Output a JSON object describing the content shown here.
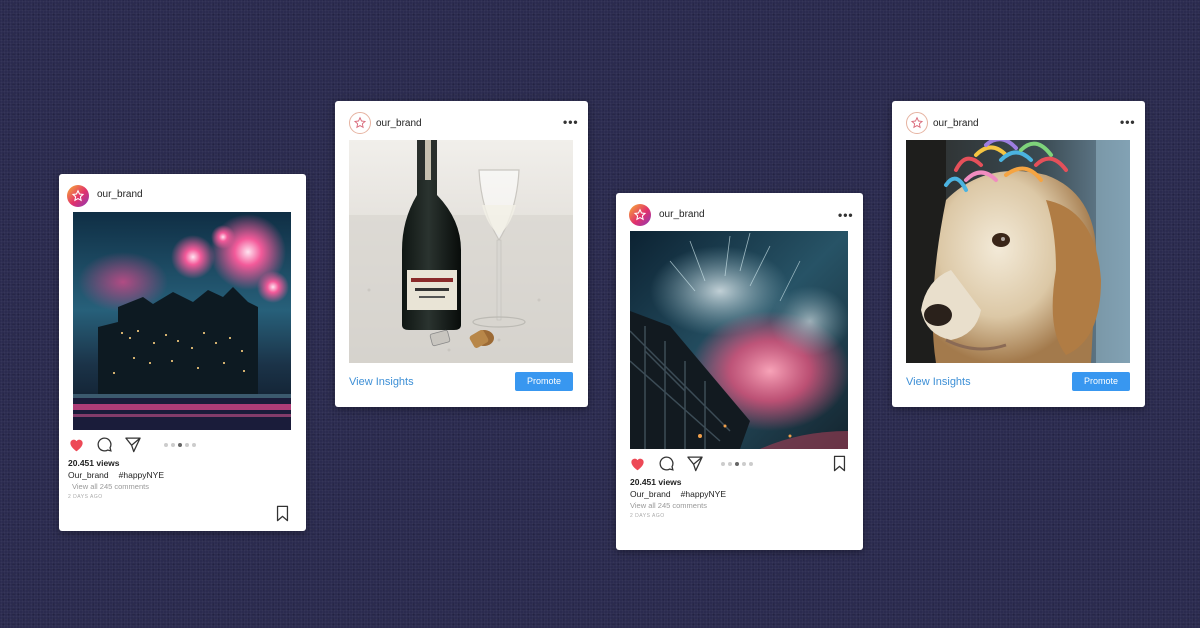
{
  "colors": {
    "background": "#2b2b4f",
    "card": "#ffffff",
    "link": "#3d8fd6",
    "button": "#3897f0",
    "heart": "#ed4956"
  },
  "posts": [
    {
      "username": "our_brand",
      "photo": "City skyline at night with pink fireworks over a waterfront",
      "views": "20.451 views",
      "caption_user": "Our_brand",
      "hashtag": "#happyNYE",
      "comments": "View all 245 comments",
      "time_ago": "2 DAYS AGO",
      "carousel_active": 2,
      "carousel_count": 5,
      "icons": {
        "more": "more-options-icon",
        "like": "heart-icon",
        "comment": "comment-icon",
        "share": "share-icon",
        "save": "bookmark-icon"
      }
    },
    {
      "username": "our_brand",
      "photo": "Champagne bottle with a glass and cork",
      "insights_label": "View Insights",
      "promote_label": "Promote"
    },
    {
      "username": "our_brand",
      "photo": "Fireworks over a bridge at night",
      "views": "20.451 views",
      "caption_user": "Our_brand",
      "hashtag": "#happyNYE",
      "comments": "View all 245 comments",
      "time_ago": "2 DAYS AGO",
      "carousel_active": 2,
      "carousel_count": 5
    },
    {
      "username": "our_brand",
      "photo": "Beagle dog wearing colorful party streamers",
      "insights_label": "View Insights",
      "promote_label": "Promote"
    }
  ]
}
